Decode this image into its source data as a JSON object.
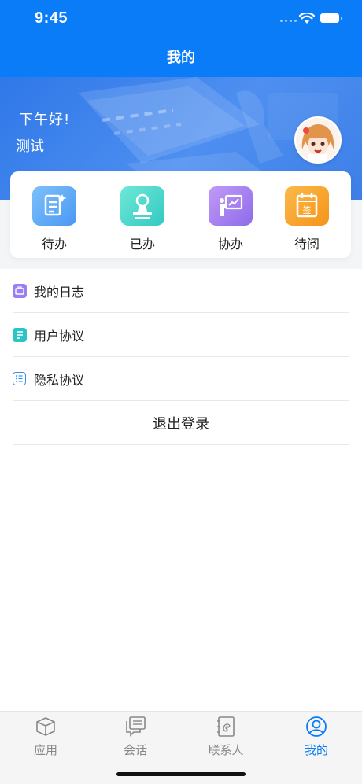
{
  "status_bar": {
    "time": "9:45"
  },
  "nav": {
    "title": "我的"
  },
  "profile": {
    "greeting": "下午好!",
    "username": "测试"
  },
  "quick_actions": [
    {
      "label": "待办",
      "icon": "todo-icon",
      "color": "#5aa6f5"
    },
    {
      "label": "已办",
      "icon": "done-stamp-icon",
      "color": "#3fd3c4"
    },
    {
      "label": "协办",
      "icon": "presentation-icon",
      "color": "#a77ff0"
    },
    {
      "label": "待阅",
      "icon": "calendar-sign-icon",
      "color": "#f9a523"
    }
  ],
  "menu": [
    {
      "label": "我的日志",
      "icon": "briefcase-icon",
      "color": "#9b7ff0"
    },
    {
      "label": "用户协议",
      "icon": "document-icon",
      "color": "#2bc2c8"
    },
    {
      "label": "隐私协议",
      "icon": "list-icon",
      "color": "#3b8ff0"
    }
  ],
  "logout_label": "退出登录",
  "tabs": [
    {
      "label": "应用",
      "icon": "cube-icon",
      "active": false
    },
    {
      "label": "会话",
      "icon": "chat-icon",
      "active": false
    },
    {
      "label": "联系人",
      "icon": "contacts-book-icon",
      "active": false
    },
    {
      "label": "我的",
      "icon": "user-icon",
      "active": true
    }
  ],
  "colors": {
    "primary": "#0a7cf7",
    "inactive_tab": "#888888"
  }
}
